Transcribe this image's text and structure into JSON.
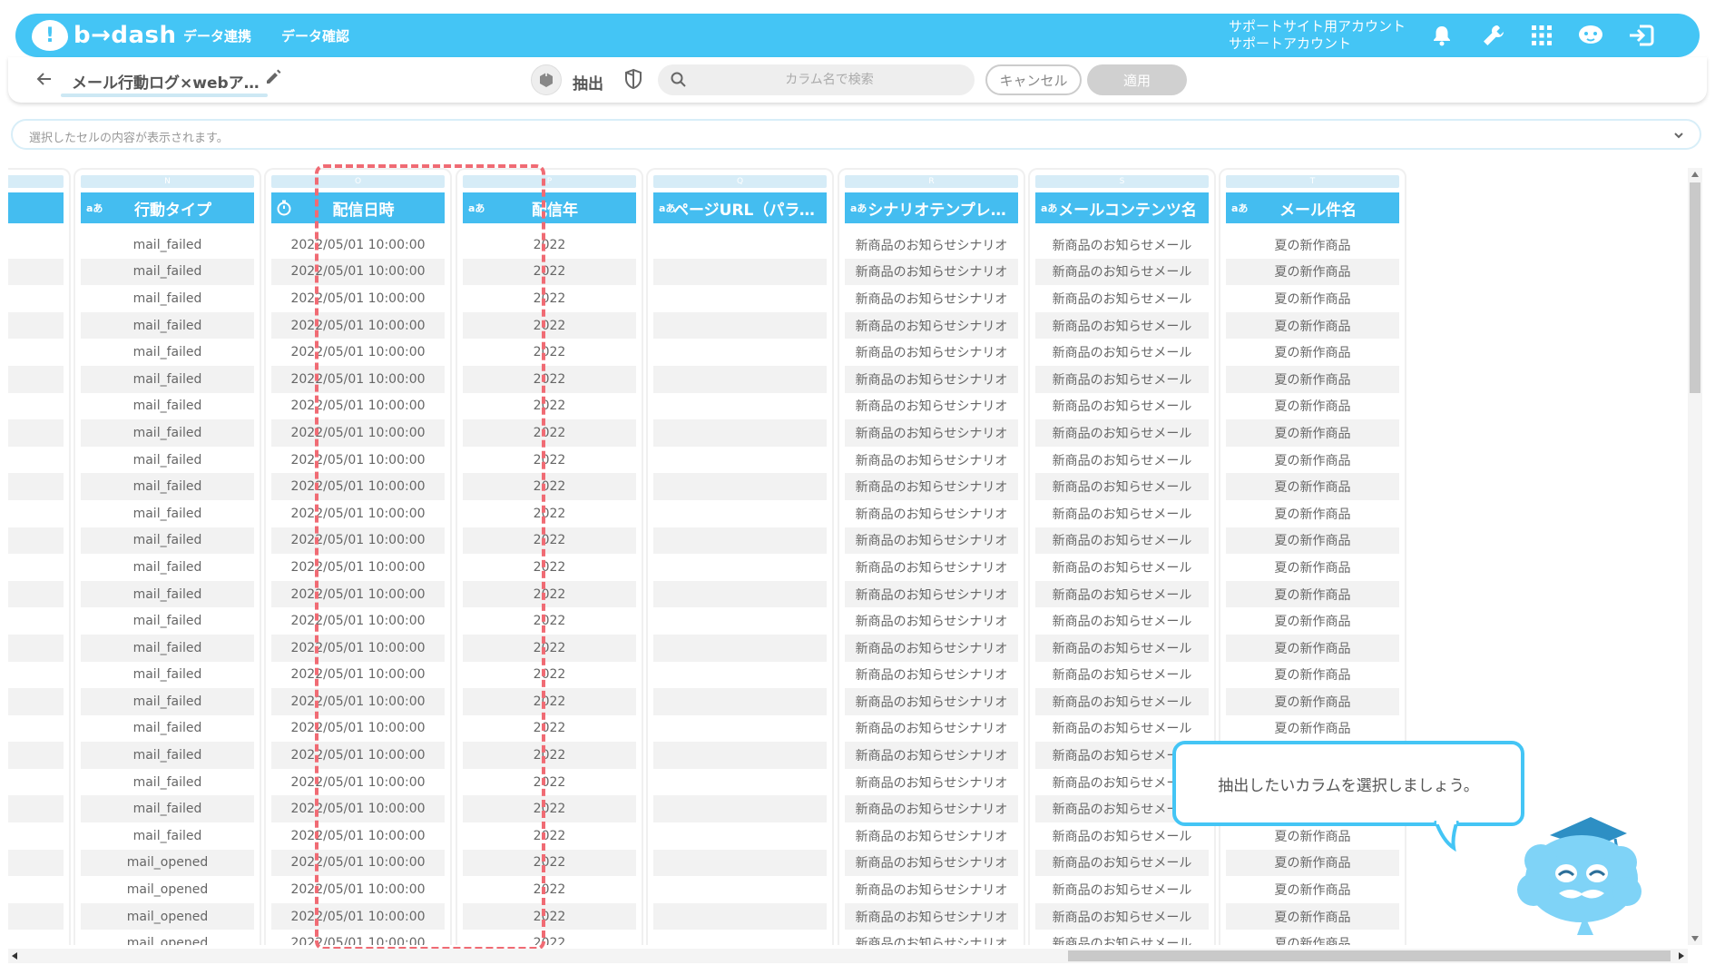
{
  "colors": {
    "accent": "#44c5f5",
    "header": "#44bdf0",
    "highlight": "#f06b74"
  },
  "topbar": {
    "logo_text": "b→dash",
    "nav": [
      "データ連携",
      "データ確認"
    ],
    "account_line1": "サポートサイト用アカウント",
    "account_line2": "サポートアカウント",
    "icons": [
      "bell-icon",
      "wrench-icon",
      "grid-icon",
      "mascot-icon",
      "logout-icon"
    ]
  },
  "subbar": {
    "title": "メール行動ログ×webア…",
    "extract_label": "抽出",
    "search_placeholder": "カラム名で検索",
    "cancel_label": "キャンセル",
    "apply_label": "適用"
  },
  "cellbar": {
    "placeholder": "選択したセルの内容が表示されます。"
  },
  "columns": [
    {
      "letter": "",
      "type": "",
      "name": "",
      "values": [
        "",
        "",
        "",
        "",
        "",
        "",
        "",
        "",
        "",
        "",
        "",
        "",
        "",
        "",
        "",
        "",
        "",
        "",
        "",
        "",
        "",
        "",
        "",
        "",
        "",
        "",
        "",
        ""
      ]
    },
    {
      "letter": "N",
      "type": "aあ",
      "name": "行動タイプ",
      "values": [
        "mail_failed",
        "mail_failed",
        "mail_failed",
        "mail_failed",
        "mail_failed",
        "mail_failed",
        "mail_failed",
        "mail_failed",
        "mail_failed",
        "mail_failed",
        "mail_failed",
        "mail_failed",
        "mail_failed",
        "mail_failed",
        "mail_failed",
        "mail_failed",
        "mail_failed",
        "mail_failed",
        "mail_failed",
        "mail_failed",
        "mail_failed",
        "mail_failed",
        "mail_failed",
        "mail_opened",
        "mail_opened",
        "mail_opened",
        "mail_opened"
      ]
    },
    {
      "letter": "O",
      "type": "clock",
      "name": "配信日時",
      "values": [
        "2022/05/01 10:00:00",
        "2022/05/01 10:00:00",
        "2022/05/01 10:00:00",
        "2022/05/01 10:00:00",
        "2022/05/01 10:00:00",
        "2022/05/01 10:00:00",
        "2022/05/01 10:00:00",
        "2022/05/01 10:00:00",
        "2022/05/01 10:00:00",
        "2022/05/01 10:00:00",
        "2022/05/01 10:00:00",
        "2022/05/01 10:00:00",
        "2022/05/01 10:00:00",
        "2022/05/01 10:00:00",
        "2022/05/01 10:00:00",
        "2022/05/01 10:00:00",
        "2022/05/01 10:00:00",
        "2022/05/01 10:00:00",
        "2022/05/01 10:00:00",
        "2022/05/01 10:00:00",
        "2022/05/01 10:00:00",
        "2022/05/01 10:00:00",
        "2022/05/01 10:00:00",
        "2022/05/01 10:00:00",
        "2022/05/01 10:00:00",
        "2022/05/01 10:00:00",
        "2022/05/01 10:00:00"
      ]
    },
    {
      "letter": "P",
      "type": "aあ",
      "name": "配信年",
      "values": [
        "2022",
        "2022",
        "2022",
        "2022",
        "2022",
        "2022",
        "2022",
        "2022",
        "2022",
        "2022",
        "2022",
        "2022",
        "2022",
        "2022",
        "2022",
        "2022",
        "2022",
        "2022",
        "2022",
        "2022",
        "2022",
        "2022",
        "2022",
        "2022",
        "2022",
        "2022",
        "2022"
      ]
    },
    {
      "letter": "Q",
      "type": "aあ",
      "name": "ページURL（パラメ…",
      "values": [
        "",
        "",
        "",
        "",
        "",
        "",
        "",
        "",
        "",
        "",
        "",
        "",
        "",
        "",
        "",
        "",
        "",
        "",
        "",
        "",
        "",
        "",
        "",
        "",
        "",
        "",
        ""
      ]
    },
    {
      "letter": "R",
      "type": "aあ",
      "name": "シナリオテンプレ…",
      "values": [
        "新商品のお知らせシナリオ",
        "新商品のお知らせシナリオ",
        "新商品のお知らせシナリオ",
        "新商品のお知らせシナリオ",
        "新商品のお知らせシナリオ",
        "新商品のお知らせシナリオ",
        "新商品のお知らせシナリオ",
        "新商品のお知らせシナリオ",
        "新商品のお知らせシナリオ",
        "新商品のお知らせシナリオ",
        "新商品のお知らせシナリオ",
        "新商品のお知らせシナリオ",
        "新商品のお知らせシナリオ",
        "新商品のお知らせシナリオ",
        "新商品のお知らせシナリオ",
        "新商品のお知らせシナリオ",
        "新商品のお知らせシナリオ",
        "新商品のお知らせシナリオ",
        "新商品のお知らせシナリオ",
        "新商品のお知らせシナリオ",
        "新商品のお知らせシナリオ",
        "新商品のお知らせシナリオ",
        "新商品のお知らせシナリオ",
        "新商品のお知らせシナリオ",
        "新商品のお知らせシナリオ",
        "新商品のお知らせシナリオ",
        "新商品のお知らせシナリオ"
      ]
    },
    {
      "letter": "S",
      "type": "aあ",
      "name": "メールコンテンツ名",
      "values": [
        "新商品のお知らせメール",
        "新商品のお知らせメール",
        "新商品のお知らせメール",
        "新商品のお知らせメール",
        "新商品のお知らせメール",
        "新商品のお知らせメール",
        "新商品のお知らせメール",
        "新商品のお知らせメール",
        "新商品のお知らせメール",
        "新商品のお知らせメール",
        "新商品のお知らせメール",
        "新商品のお知らせメール",
        "新商品のお知らせメール",
        "新商品のお知らせメール",
        "新商品のお知らせメール",
        "新商品のお知らせメール",
        "新商品のお知らせメール",
        "新商品のお知らせメール",
        "新商品のお知らせメール",
        "新商品のお知らせメール",
        "新商品のお知らせメール",
        "新商品のお知らせメール",
        "新商品のお知らせメール",
        "新商品のお知らせメール",
        "新商品のお知らせメール",
        "新商品のお知らせメール",
        "新商品のお知らせメール"
      ]
    },
    {
      "letter": "T",
      "type": "aあ",
      "name": "メール件名",
      "values": [
        "夏の新作商品",
        "夏の新作商品",
        "夏の新作商品",
        "夏の新作商品",
        "夏の新作商品",
        "夏の新作商品",
        "夏の新作商品",
        "夏の新作商品",
        "夏の新作商品",
        "夏の新作商品",
        "夏の新作商品",
        "夏の新作商品",
        "夏の新作商品",
        "夏の新作商品",
        "夏の新作商品",
        "夏の新作商品",
        "夏の新作商品",
        "夏の新作商品",
        "夏の新作商品",
        "夏の新作商品",
        "夏の新作商品",
        "夏の新作商品",
        "夏の新作商品",
        "夏の新作商品",
        "夏の新作商品",
        "夏の新作商品",
        "夏の新作商品"
      ]
    }
  ],
  "tooltip": {
    "text": "抽出したいカラムを選択しましょう。"
  }
}
